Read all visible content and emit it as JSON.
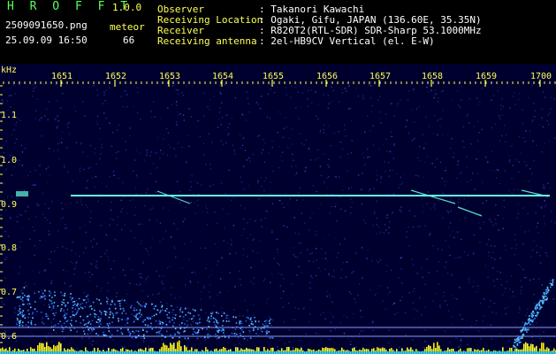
{
  "header": {
    "app_name": "H R O F F T",
    "version": "1.0.0",
    "filename": "2509091650.png",
    "meteor_label": "meteor",
    "datetime": "25.09.09 16:50",
    "meteor_count": "66",
    "info": [
      {
        "key": "Observer",
        "value": ": Takanori Kawachi"
      },
      {
        "key": "Receiving Location",
        "value": ": Ogaki, Gifu, JAPAN (136.60E, 35.35N)"
      },
      {
        "key": "Receiver",
        "value": ": R820T2(RTL-SDR) SDR-Sharp 53.1000MHz"
      },
      {
        "key": "Receiving antenna",
        "value": ": 2el-HB9CV Vertical (el. E-W)"
      }
    ]
  },
  "spectrogram": {
    "unit_label": "kHz",
    "time_ticks": [
      "1651",
      "1652",
      "1653",
      "1654",
      "1655",
      "1656",
      "1657",
      "1658",
      "1659",
      "1700"
    ],
    "freq_ticks": [
      "1.1",
      "1.0",
      "0.9",
      "0.8",
      "0.7",
      "0.6"
    ],
    "colors": {
      "background": "#00002e",
      "noise": "#2233aa",
      "carrier": "#66ffee",
      "axis": "#ffff55",
      "text": "#5cff5c"
    }
  }
}
